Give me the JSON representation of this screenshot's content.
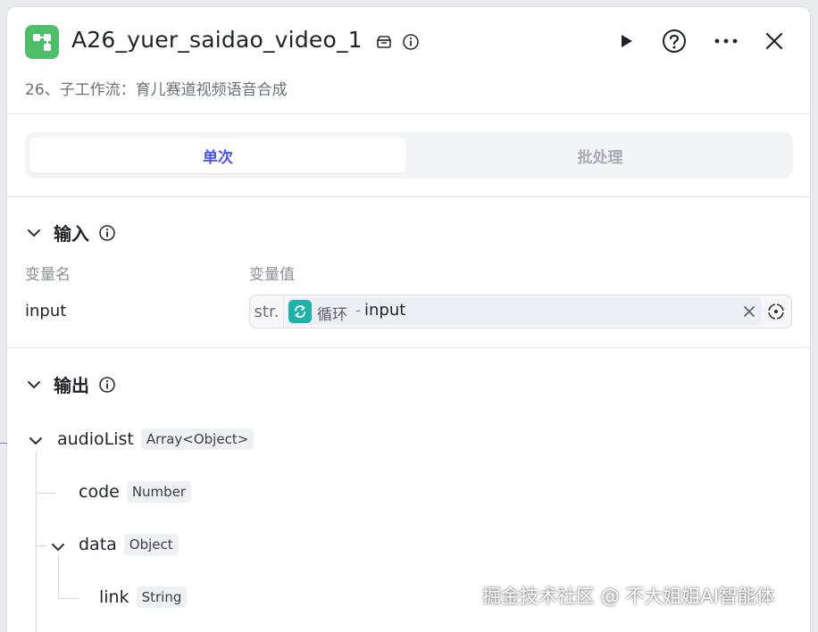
{
  "header": {
    "title": "A26_yuer_saidao_video_1",
    "subtitle": "26、子工作流：育儿赛道视频语音合成",
    "node_icon": "workflow-icon",
    "accent": "#4fbe6b"
  },
  "tabs": [
    {
      "label": "单次",
      "active": true
    },
    {
      "label": "批处理",
      "active": false
    }
  ],
  "input_section": {
    "title": "输入",
    "col_name": "变量名",
    "col_value": "变量值",
    "variable": {
      "name": "input",
      "type_prefix": "str.",
      "ref_node": "循环",
      "ref_sep": "-",
      "ref_var": "input"
    }
  },
  "output_section": {
    "title": "输出",
    "fields": [
      {
        "name": "audioList",
        "type": "Array<Object>"
      },
      {
        "name": "code",
        "type": "Number"
      },
      {
        "name": "data",
        "type": "Object"
      },
      {
        "name": "link",
        "type": "String"
      }
    ]
  },
  "watermark": "掘金技术社区 @ 不大姐姐AI智能体",
  "colors": {
    "primary": "#4d53e8",
    "loop": "#1fb3a8"
  }
}
